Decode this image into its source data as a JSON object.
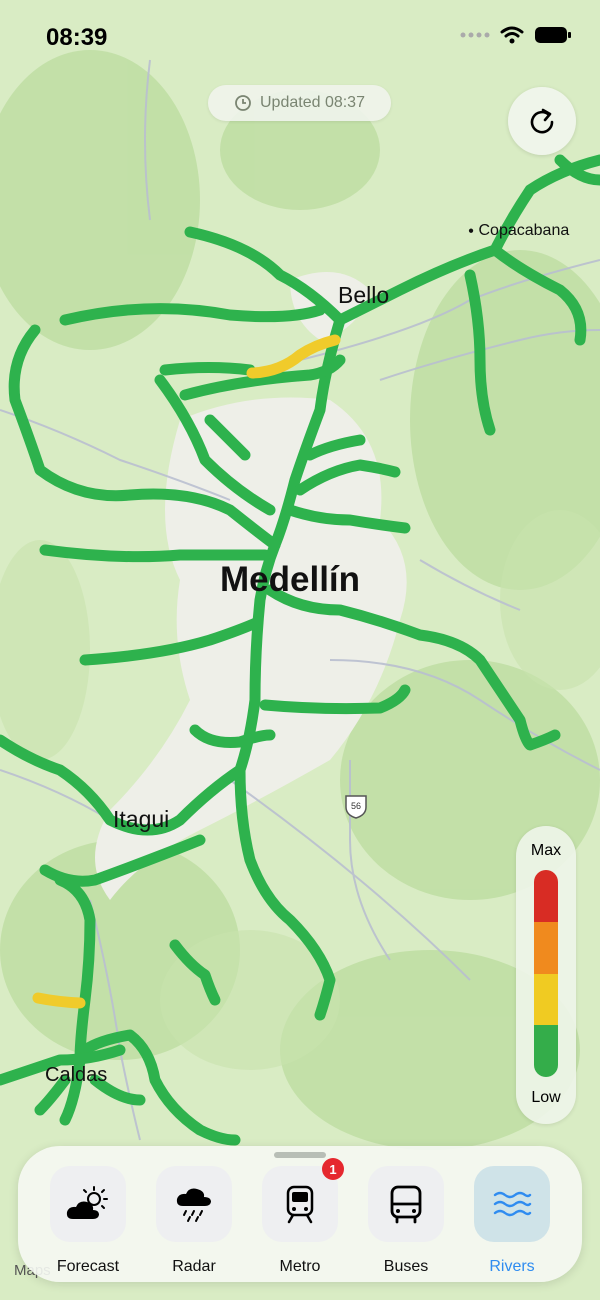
{
  "status_bar": {
    "time": "08:39"
  },
  "updated_pill": {
    "text": "Updated 08:37",
    "icon": "clock-icon"
  },
  "refresh_button": {
    "icon": "refresh-icon"
  },
  "map": {
    "labels": {
      "bello": "Bello",
      "copacabana": "Copacabana",
      "medellin": "Medellín",
      "itagui": "Itagui",
      "caldas": "Caldas"
    },
    "route_shield": "56",
    "attribution": "Maps",
    "colors": {
      "normal_river": "#2eb24d",
      "elevated_river": "#f0cb2b",
      "land": "#d9ecc4",
      "urban": "#eeefe8"
    }
  },
  "legend": {
    "max_label": "Max",
    "low_label": "Low",
    "levels": [
      {
        "color": "#d82c24"
      },
      {
        "color": "#f08a1e"
      },
      {
        "color": "#f0cb22"
      },
      {
        "color": "#34ad4a"
      }
    ]
  },
  "tabs": [
    {
      "label": "Forecast",
      "icon": "partly-cloudy-icon",
      "active": false
    },
    {
      "label": "Radar",
      "icon": "rain-cloud-icon",
      "active": false
    },
    {
      "label": "Metro",
      "icon": "tram-icon",
      "active": false,
      "badge": "1"
    },
    {
      "label": "Buses",
      "icon": "bus-icon",
      "active": false
    },
    {
      "label": "Rivers",
      "icon": "water-waves-icon",
      "active": true
    }
  ],
  "active_color": "#2f8cf0"
}
